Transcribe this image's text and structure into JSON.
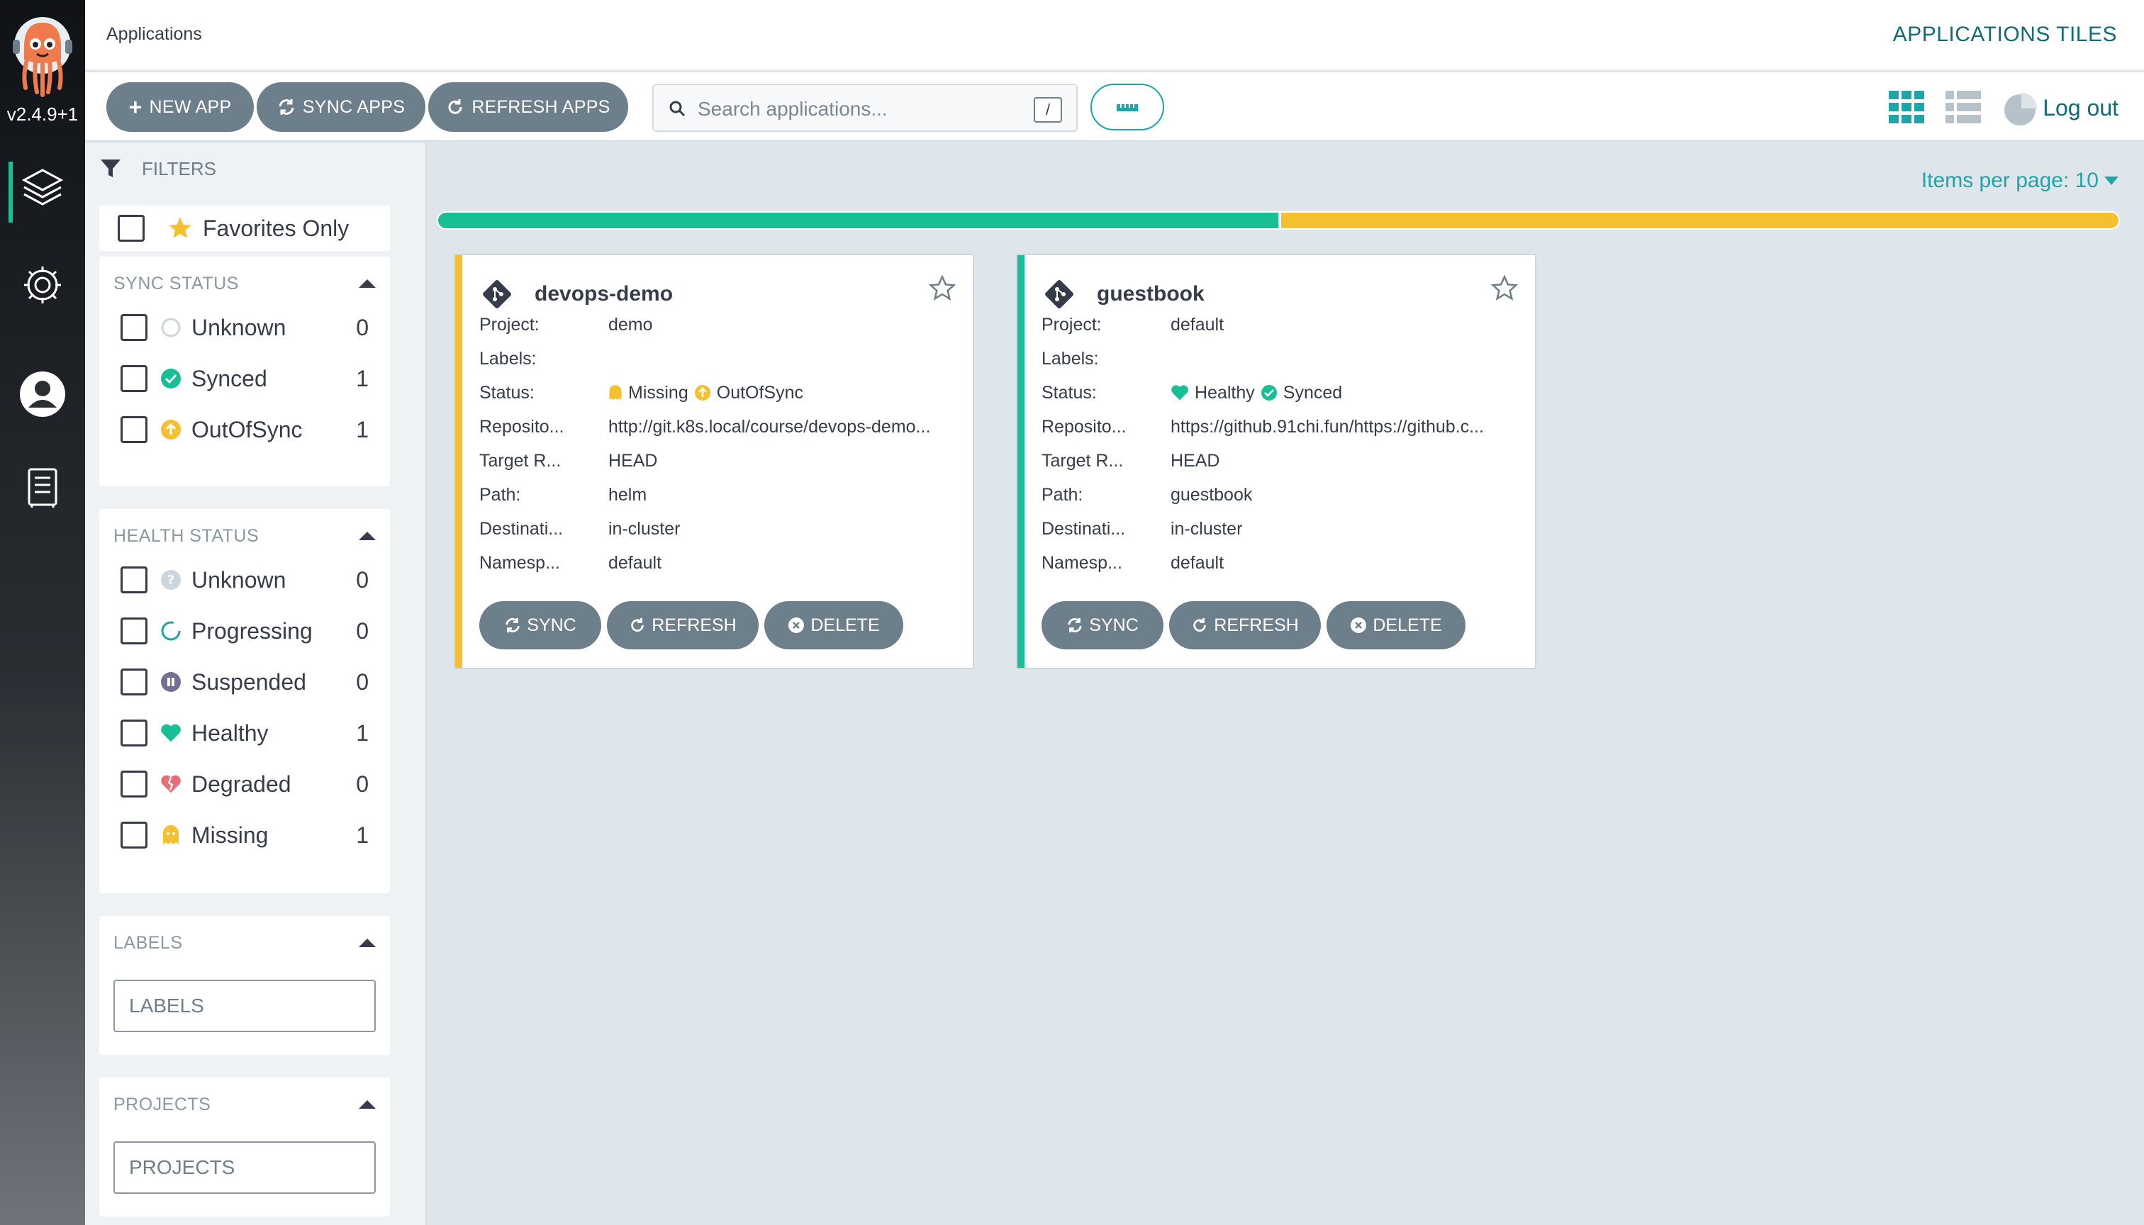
{
  "app": {
    "version": "v2.4.9+1",
    "breadcrumb": "Applications",
    "view_title": "APPLICATIONS TILES"
  },
  "nav": {
    "items": [
      {
        "name": "applications",
        "icon": "layers-icon"
      },
      {
        "name": "settings",
        "icon": "gear-icon"
      },
      {
        "name": "user-info",
        "icon": "user-circle-icon"
      },
      {
        "name": "documentation",
        "icon": "book-icon"
      }
    ]
  },
  "toolbar": {
    "new_app": "NEW APP",
    "sync_apps": "SYNC APPS",
    "refresh_apps": "REFRESH APPS",
    "search_placeholder": "Search applications...",
    "search_shortcut": "/",
    "logout": "Log out"
  },
  "filters": {
    "header": "FILTERS",
    "favorites_label": "Favorites Only",
    "sync_status": {
      "title": "SYNC STATUS",
      "items": [
        {
          "label": "Unknown",
          "count": "0",
          "icon": "circle-outline-icon"
        },
        {
          "label": "Synced",
          "count": "1",
          "icon": "check-circle-icon"
        },
        {
          "label": "OutOfSync",
          "count": "1",
          "icon": "arrow-up-circle-icon"
        }
      ]
    },
    "health_status": {
      "title": "HEALTH STATUS",
      "items": [
        {
          "label": "Unknown",
          "count": "0",
          "icon": "question-circle-icon"
        },
        {
          "label": "Progressing",
          "count": "0",
          "icon": "spinner-icon"
        },
        {
          "label": "Suspended",
          "count": "0",
          "icon": "pause-circle-icon"
        },
        {
          "label": "Healthy",
          "count": "1",
          "icon": "heart-icon"
        },
        {
          "label": "Degraded",
          "count": "0",
          "icon": "broken-heart-icon"
        },
        {
          "label": "Missing",
          "count": "1",
          "icon": "ghost-icon"
        }
      ]
    },
    "labels": {
      "title": "LABELS",
      "placeholder": "LABELS"
    },
    "projects": {
      "title": "PROJECTS",
      "placeholder": "PROJECTS"
    }
  },
  "main": {
    "items_per_page": "Items per page: 10",
    "progress": {
      "synced_fraction": 0.5,
      "outofsync_fraction": 0.5
    },
    "colors": {
      "healthy": "#18be94",
      "missing": "#f4c030",
      "button": "#6d7f8b",
      "accent": "#21a4a8"
    }
  },
  "apps": [
    {
      "name": "devops-demo",
      "stripe_color": "#f4c030",
      "rows": [
        {
          "key": "Project:",
          "value": "demo"
        },
        {
          "key": "Labels:",
          "value": ""
        },
        {
          "key": "Status:",
          "health": "Missing",
          "sync": "OutOfSync"
        },
        {
          "key": "Reposito...",
          "value": "http://git.k8s.local/course/devops-demo..."
        },
        {
          "key": "Target R...",
          "value": "HEAD"
        },
        {
          "key": "Path:",
          "value": "helm"
        },
        {
          "key": "Destinati...",
          "value": "in-cluster"
        },
        {
          "key": "Namesp...",
          "value": "default"
        }
      ],
      "buttons": {
        "sync": "SYNC",
        "refresh": "REFRESH",
        "delete": "DELETE"
      }
    },
    {
      "name": "guestbook",
      "stripe_color": "#18be94",
      "rows": [
        {
          "key": "Project:",
          "value": "default"
        },
        {
          "key": "Labels:",
          "value": ""
        },
        {
          "key": "Status:",
          "health": "Healthy",
          "sync": "Synced"
        },
        {
          "key": "Reposito...",
          "value": "https://github.91chi.fun/https://github.c..."
        },
        {
          "key": "Target R...",
          "value": "HEAD"
        },
        {
          "key": "Path:",
          "value": "guestbook"
        },
        {
          "key": "Destinati...",
          "value": "in-cluster"
        },
        {
          "key": "Namesp...",
          "value": "default"
        }
      ],
      "buttons": {
        "sync": "SYNC",
        "refresh": "REFRESH",
        "delete": "DELETE"
      }
    }
  ]
}
